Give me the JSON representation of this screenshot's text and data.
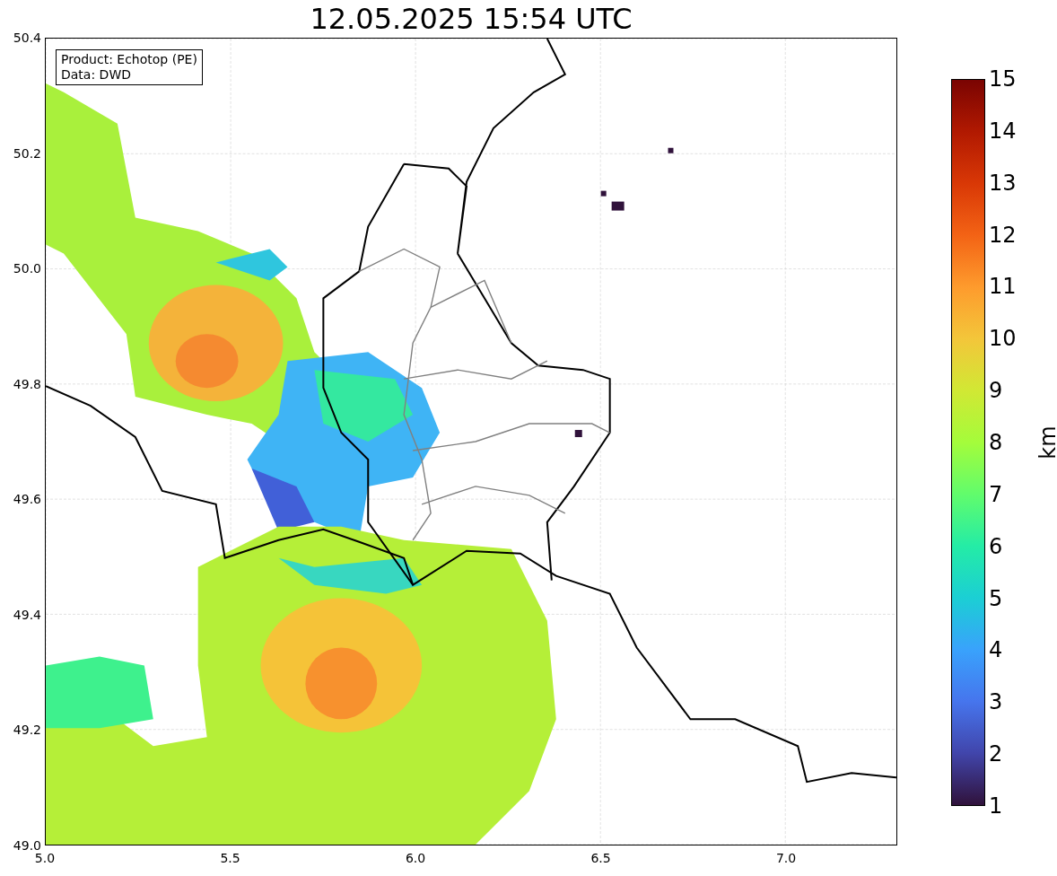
{
  "title": "12.05.2025 15:54 UTC",
  "annotation": {
    "lines": [
      "Product: Echotop (PE)",
      "Data: DWD"
    ]
  },
  "map": {
    "xticks": [
      "5.0",
      "5.5",
      "6.0",
      "6.5",
      "7.0"
    ],
    "yticks": [
      "50.4",
      "50.2",
      "50.0",
      "49.8",
      "49.6",
      "49.4",
      "49.2",
      "49.0"
    ]
  },
  "colorbar": {
    "label": "km",
    "ticks": [
      "15",
      "14",
      "13",
      "12",
      "11",
      "10",
      "9",
      "8",
      "7",
      "6",
      "5",
      "4",
      "3",
      "2",
      "1"
    ]
  }
}
